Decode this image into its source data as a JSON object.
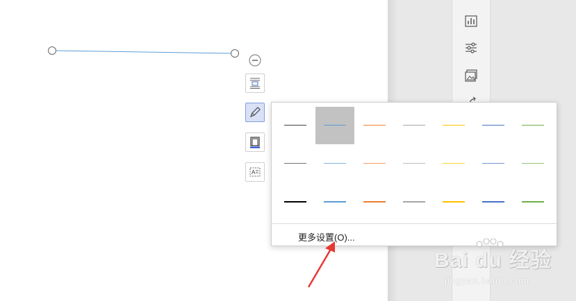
{
  "popup": {
    "more_settings": "更多设置(O)..."
  },
  "line_styles": {
    "rows": [
      {
        "colors": [
          "#404040",
          "#5b9bd5",
          "#ed7d31",
          "#a5a5a5",
          "#ffc000",
          "#4472c4",
          "#70ad47"
        ],
        "weight": "thin"
      },
      {
        "colors": [
          "#404040",
          "#5b9bd5",
          "#ed7d31",
          "#a5a5a5",
          "#ffc000",
          "#4472c4",
          "#70ad47"
        ],
        "weight": "light"
      },
      {
        "colors": [
          "#000000",
          "#5b9bd5",
          "#ed7d31",
          "#a5a5a5",
          "#ffc000",
          "#4472c4",
          "#70ad47"
        ],
        "weight": "medium"
      }
    ],
    "selected": "row1-col2"
  },
  "watermark": {
    "brand": "Bai du 经验",
    "url": "jingyan.baidu.com"
  },
  "colors": {
    "accent": "#5b9bd5",
    "annotation": "#e53935"
  }
}
